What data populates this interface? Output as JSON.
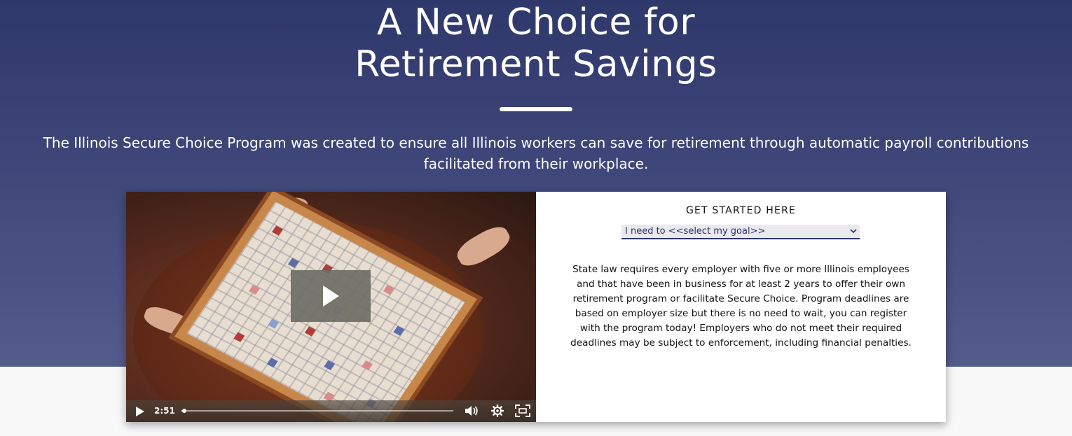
{
  "hero": {
    "title_line1": "A New Choice for",
    "title_line2": "Retirement Savings",
    "subtitle": "The Illinois Secure Choice Program was created to ensure all Illinois workers can save for retirement through automatic payroll contributions facilitated from their workplace.",
    "colors": {
      "background_top": "#2f386b",
      "background_bottom": "#545c8c",
      "text": "#ffffff"
    }
  },
  "video": {
    "time": "2:51",
    "progress": 0.01,
    "icons": [
      "play-icon",
      "volume-icon",
      "settings-icon",
      "fullscreen-icon"
    ]
  },
  "get_started": {
    "heading": "GET STARTED HERE",
    "select_value": "I need to <<select my goal>>",
    "body": "State law requires every employer with five or more Illinois employees and that have been in business for at least 2 years to offer their own retirement program or facilitate Secure Choice. Program deadlines are based on employer size but there is no need to wait, you can register with the program today! Employers who do not meet their required deadlines may be subject to enforcement, including financial penalties.",
    "accent_color": "#2d336a"
  }
}
